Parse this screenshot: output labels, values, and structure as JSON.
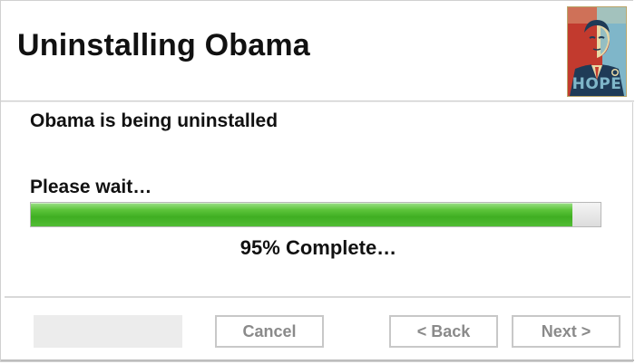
{
  "window": {
    "title": "Uninstalling Obama"
  },
  "poster": {
    "label": "HOPE",
    "colors": {
      "background": "#e8d9a6",
      "red": "#c23a2e",
      "navy": "#1f3b57",
      "lightblue": "#7fb6c9"
    }
  },
  "status": {
    "heading": "Obama is being uninstalled",
    "wait_label": "Please wait…",
    "progress_percent": 95,
    "progress_text": "95% Complete…",
    "accent_color": "#4cbb2d"
  },
  "buttons": {
    "cancel": "Cancel",
    "back": "< Back",
    "next": "Next >"
  }
}
